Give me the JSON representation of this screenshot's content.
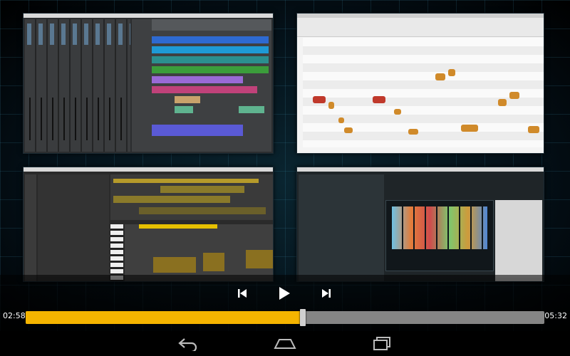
{
  "player": {
    "current_time": "02:58",
    "total_time": "05:32",
    "progress_fraction": 0.535
  },
  "controls": {
    "previous_icon": "skip-previous-icon",
    "play_icon": "play-icon",
    "next_icon": "skip-next-icon"
  },
  "navbar": {
    "back_icon": "back-arrow-icon",
    "home_icon": "home-icon",
    "recents_icon": "recent-apps-icon"
  },
  "video_content": {
    "tiles": [
      "pro-tools-session",
      "melodyne-editor",
      "logic-pro-session",
      "drum-machine-plugin"
    ]
  },
  "colors": {
    "accent": "#f5b400",
    "track": "#858585",
    "thumb": "#d0d0d0",
    "background": "#000000"
  }
}
